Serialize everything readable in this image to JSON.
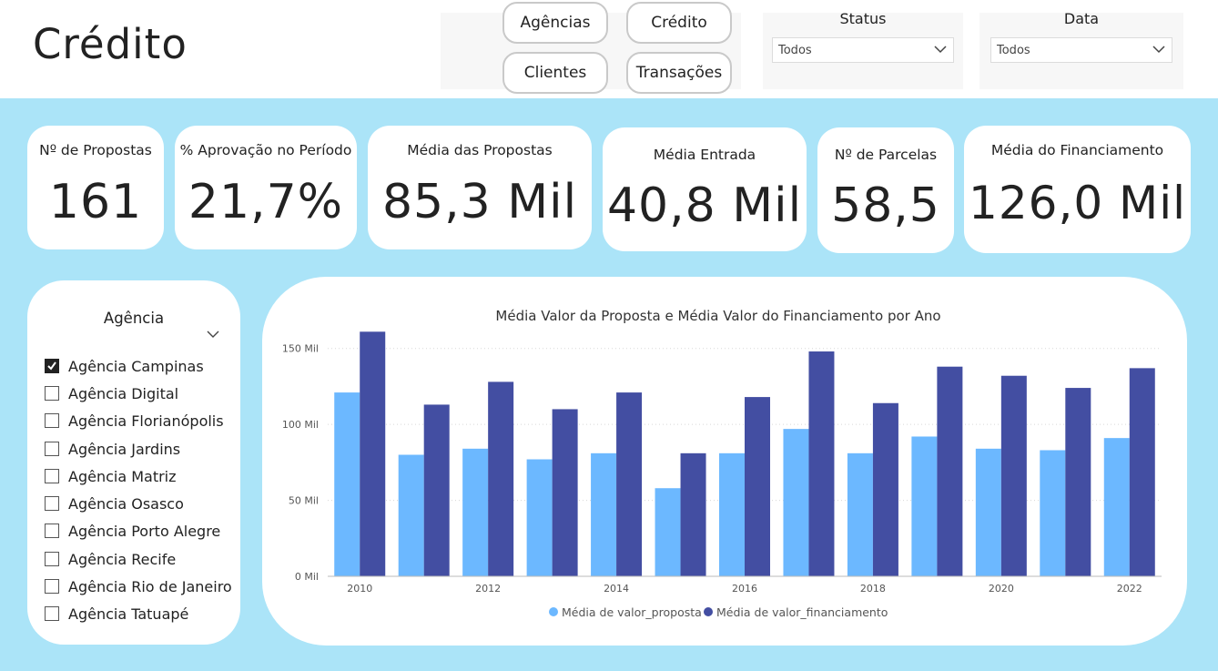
{
  "header": {
    "title": "Crédito",
    "nav_buttons": [
      {
        "label": "Agências"
      },
      {
        "label": "Crédito"
      },
      {
        "label": "Clientes"
      },
      {
        "label": "Transações"
      }
    ],
    "filters": {
      "status": {
        "label": "Status",
        "value": "Todos"
      },
      "data": {
        "label": "Data",
        "value": "Todos"
      }
    }
  },
  "kpis": [
    {
      "label": "Nº de Propostas",
      "value": "161"
    },
    {
      "label": "% Aprovação no Período",
      "value": "21,7%"
    },
    {
      "label": "Média das Propostas",
      "value": "85,3 Mil"
    },
    {
      "label": "Média Entrada",
      "value": "40,8 Mil"
    },
    {
      "label": "Nº de Parcelas",
      "value": "58,5"
    },
    {
      "label": "Média do Financiamento",
      "value": "126,0 Mil"
    }
  ],
  "agency_slicer": {
    "title": "Agência",
    "items": [
      {
        "label": "Agência Campinas",
        "checked": true
      },
      {
        "label": "Agência Digital",
        "checked": false
      },
      {
        "label": "Agência Florianópolis",
        "checked": false
      },
      {
        "label": "Agência Jardins",
        "checked": false
      },
      {
        "label": "Agência Matriz",
        "checked": false
      },
      {
        "label": "Agência Osasco",
        "checked": false
      },
      {
        "label": "Agência Porto Alegre",
        "checked": false
      },
      {
        "label": "Agência Recife",
        "checked": false
      },
      {
        "label": "Agência Rio de Janeiro",
        "checked": false
      },
      {
        "label": "Agência Tatuapé",
        "checked": false
      }
    ]
  },
  "colors": {
    "background": "#abe4f8",
    "series_proposta": "#6cb8ff",
    "series_financiamento": "#434ea2"
  },
  "chart_data": {
    "type": "bar",
    "title": "Média Valor da Proposta e Média Valor do Financiamento por Ano",
    "x": [
      2010,
      2011,
      2012,
      2013,
      2014,
      2015,
      2016,
      2017,
      2018,
      2019,
      2020,
      2021,
      2022
    ],
    "x_tick_labels": [
      "2010",
      "2012",
      "2014",
      "2016",
      "2018",
      "2020",
      "2022"
    ],
    "y_tick_labels": [
      "0 Mil",
      "50 Mil",
      "100 Mil",
      "150 Mil"
    ],
    "ylim": [
      0,
      160
    ],
    "grid": true,
    "legend_position": "bottom",
    "series": [
      {
        "name": "Média de valor_proposta",
        "color": "#6cb8ff",
        "values": [
          121,
          80,
          84,
          77,
          81,
          58,
          81,
          97,
          81,
          92,
          84,
          83,
          91
        ]
      },
      {
        "name": "Média de valor_financiamento",
        "color": "#434ea2",
        "values": [
          161,
          113,
          128,
          110,
          121,
          81,
          118,
          148,
          114,
          138,
          132,
          124,
          137
        ]
      }
    ]
  }
}
